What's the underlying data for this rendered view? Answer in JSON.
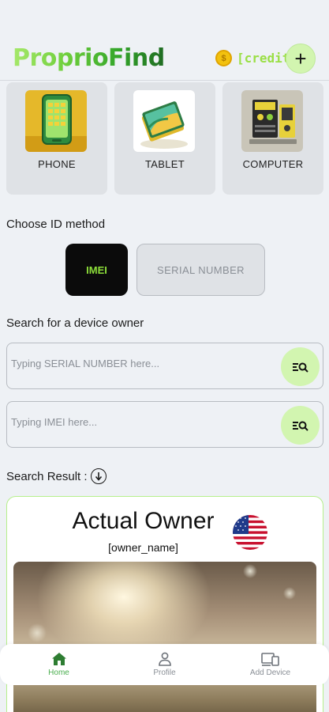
{
  "header": {
    "app_title": "ProprioFind",
    "credit_label": "[credit]",
    "add_label": "+"
  },
  "categories": [
    {
      "label": "PHONE",
      "icon": "phone-illustration"
    },
    {
      "label": "TABLET",
      "icon": "tablet-illustration"
    },
    {
      "label": "COMPUTER",
      "icon": "computer-illustration"
    }
  ],
  "id_method": {
    "heading": "Choose ID method",
    "options": [
      "IMEI",
      "SERIAL NUMBER"
    ],
    "selected": "IMEI"
  },
  "search": {
    "heading": "Search for a device owner",
    "serial_placeholder": "Typing SERIAL NUMBER here...",
    "imei_placeholder": "Typing IMEI here..."
  },
  "result": {
    "heading": "Search Result :",
    "owner_title": "Actual Owner",
    "owner_name": "[owner_name]",
    "flag": "us-flag-icon"
  },
  "nav": {
    "items": [
      {
        "label": "Home",
        "icon": "home-icon"
      },
      {
        "label": "Profile",
        "icon": "person-icon"
      },
      {
        "label": "Add Device",
        "icon": "devices-icon"
      }
    ],
    "active": "Home"
  },
  "colors": {
    "accent": "#8ddf3a",
    "button_bg": "#d2f5b0",
    "background": "#eef1f5",
    "card": "#dfe2e6"
  }
}
